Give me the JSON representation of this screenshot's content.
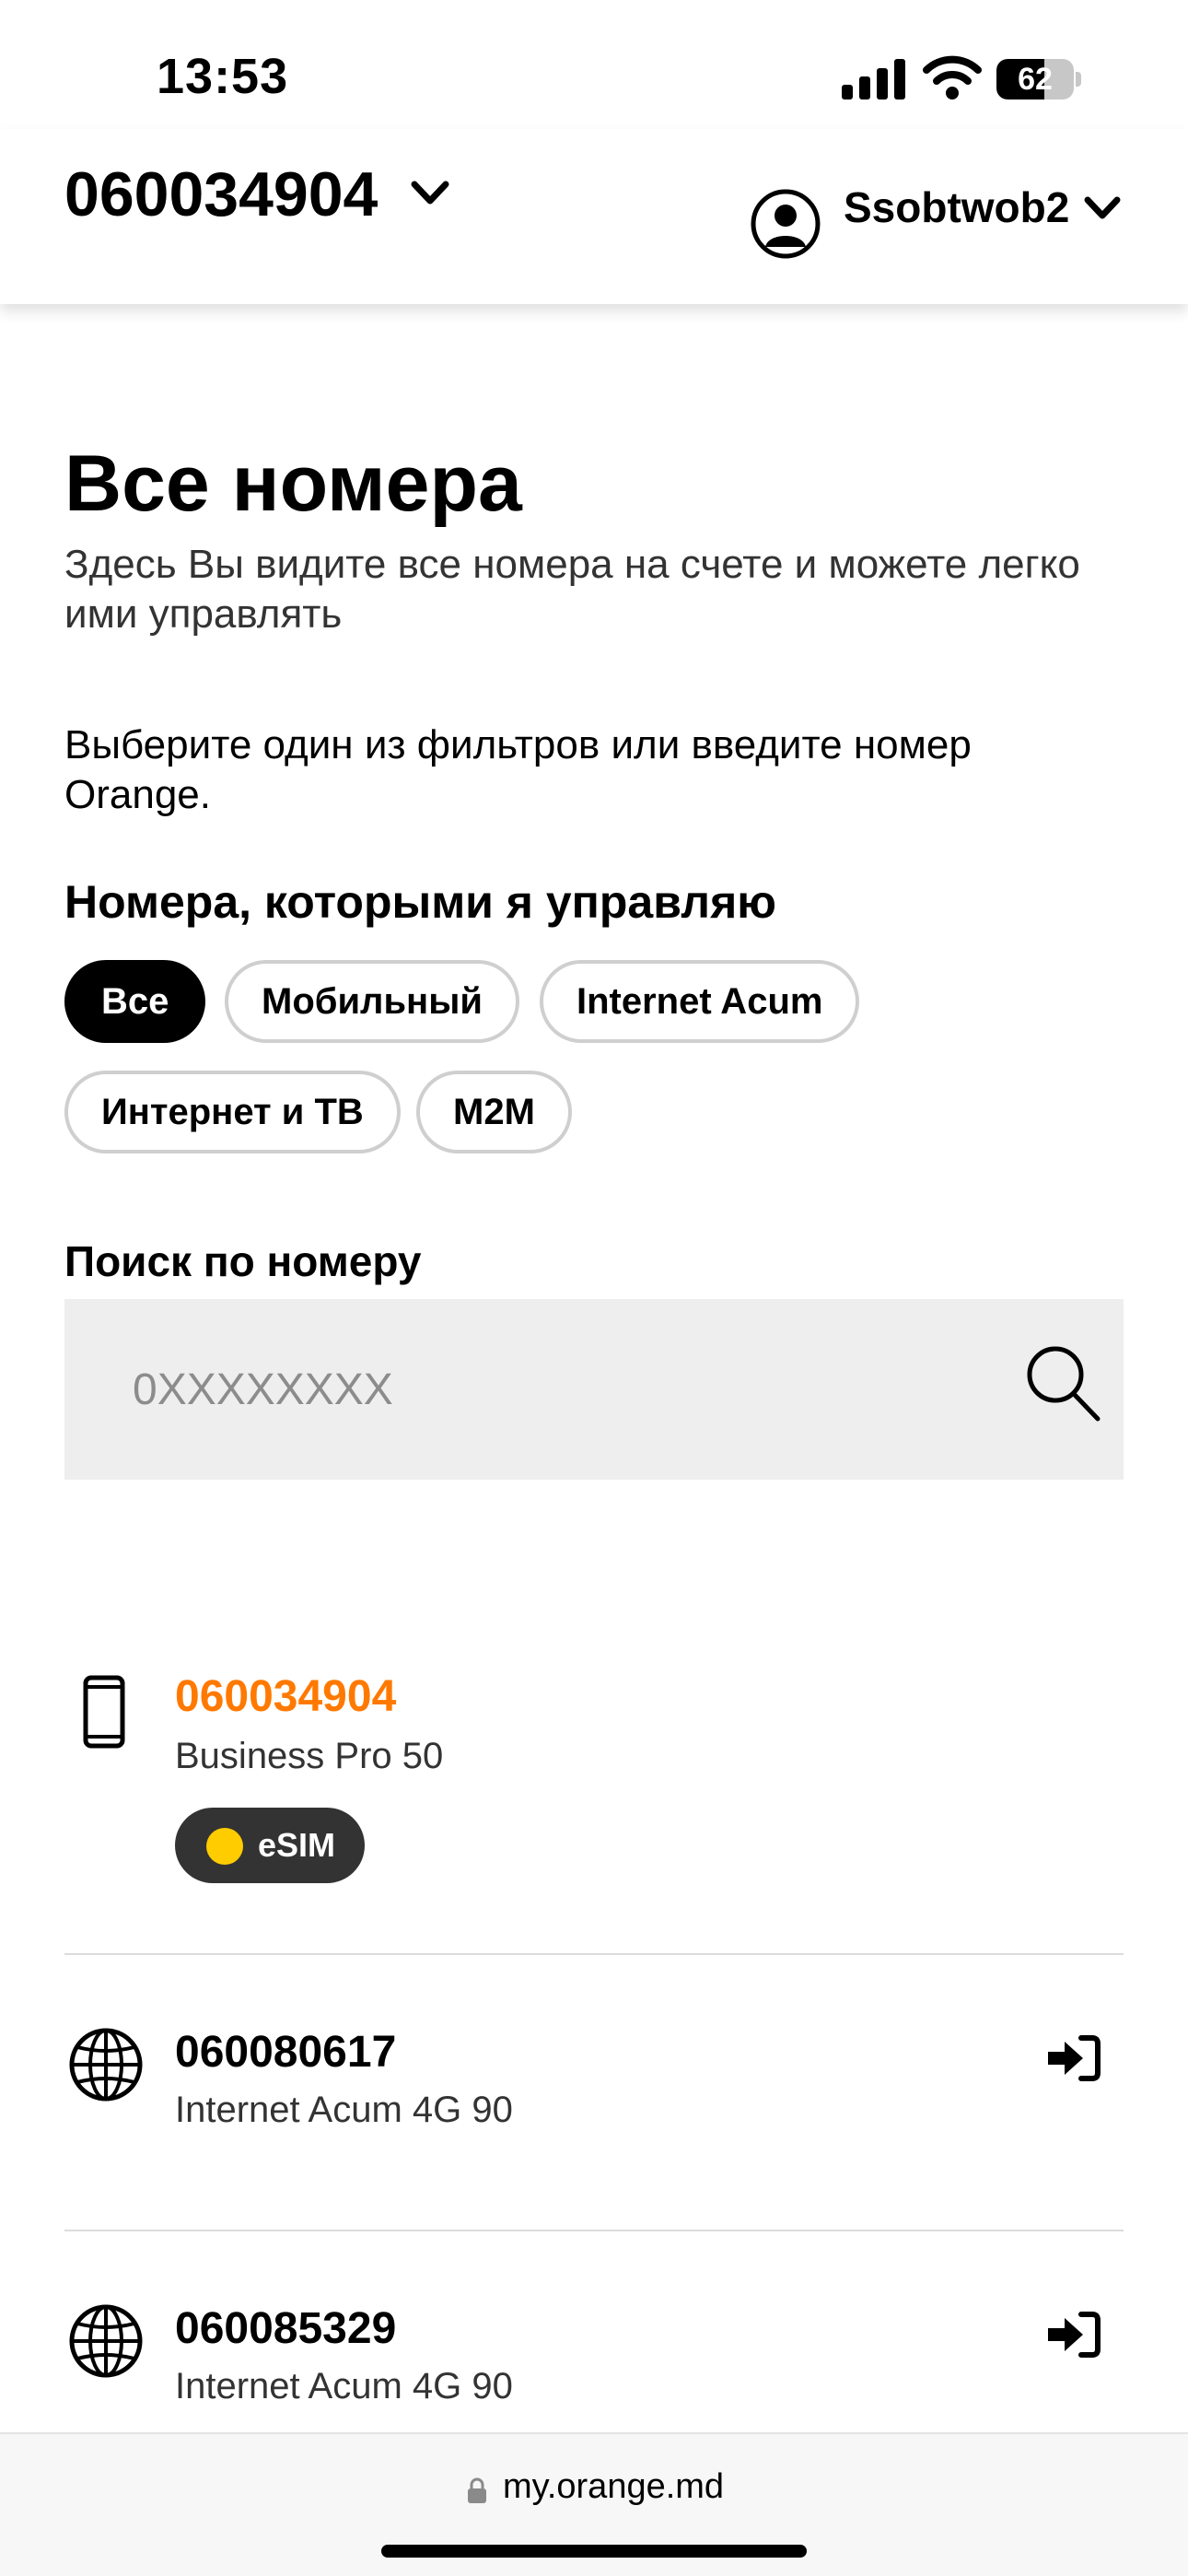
{
  "status_bar": {
    "time": "13:53",
    "battery_level": "62",
    "signal_icon": "cellular-signal-icon",
    "wifi_icon": "wifi-icon"
  },
  "header": {
    "account_number": "060034904",
    "user_name": "Ssobtwob2"
  },
  "page": {
    "title": "Все номера",
    "subtitle": "Здесь Вы видите все номера на счете и можете легко ими управлять",
    "filter_instruction": "Выберите один из фильтров или введите номер Orange.",
    "filters_title": "Номера, которыми я управляю",
    "filters": [
      {
        "label": "Все",
        "active": true
      },
      {
        "label": "Мобильный",
        "active": false
      },
      {
        "label": "Internet Acum",
        "active": false
      },
      {
        "label": "Интернет и ТВ",
        "active": false
      },
      {
        "label": "M2M",
        "active": false
      }
    ],
    "search": {
      "label": "Поиск по номеру",
      "placeholder": "0XXXXXXXX"
    }
  },
  "numbers": [
    {
      "number": "060034904",
      "plan": "Business Pro 50",
      "icon": "mobile-phone-icon",
      "badge": "eSIM",
      "current": true
    },
    {
      "number": "060080617",
      "plan": "Internet Acum 4G 90",
      "icon": "globe-icon",
      "action_icon": "sign-in-icon"
    },
    {
      "number": "060085329",
      "plan": "Internet Acum 4G 90",
      "icon": "globe-icon",
      "action_icon": "sign-in-icon"
    }
  ],
  "browser": {
    "url": "my.orange.md"
  },
  "colors": {
    "accent": "#ff7900",
    "esim_dot": "#ffcc00",
    "esim_badge_bg": "#333333",
    "search_bg": "#eeeeee",
    "chip_border": "#cfcfcf"
  }
}
